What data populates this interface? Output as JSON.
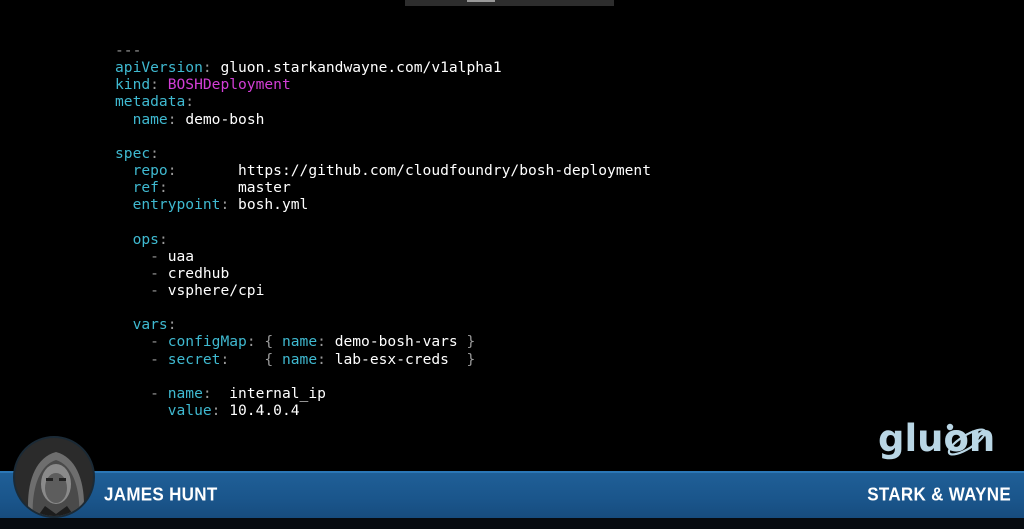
{
  "window": {
    "title": ""
  },
  "code": {
    "doc_marker": "---",
    "apiVersion_key": "apiVersion",
    "apiVersion_value": "gluon.starkandwayne.com/v1alpha1",
    "kind_key": "kind",
    "kind_value": "BOSHDeployment",
    "metadata_key": "metadata",
    "name_key": "name",
    "name_value": "demo-bosh",
    "spec_key": "spec",
    "repo_key": "repo",
    "repo_value": "https://github.com/cloudfoundry/bosh-deployment",
    "ref_key": "ref",
    "ref_value": "master",
    "entrypoint_key": "entrypoint",
    "entrypoint_value": "bosh.yml",
    "ops_key": "ops",
    "ops_items": [
      "uaa",
      "credhub",
      "vsphere/cpi"
    ],
    "vars_key": "vars",
    "configMap_key": "configMap",
    "configMap_name_key": "name",
    "configMap_name_value": "demo-bosh-vars",
    "secret_key": "secret",
    "secret_name_key": "name",
    "secret_name_value": "lab-esx-creds",
    "var_name_key": "name",
    "var_name_value": "internal_ip",
    "var_value_key": "value",
    "var_value_value": "10.4.0.4"
  },
  "lower_third": {
    "presenter_name": "JAMES HUNT",
    "company": "STARK & WAYNE"
  },
  "logo": {
    "text": "gluon"
  },
  "colors": {
    "key": "#3fb9d0",
    "magenta": "#d23ed6",
    "bar": "#1f5f97",
    "logo": "#b9d6e5"
  },
  "icons": {
    "avatar": "presenter-avatar",
    "logo": "gluon-logo-icon"
  }
}
